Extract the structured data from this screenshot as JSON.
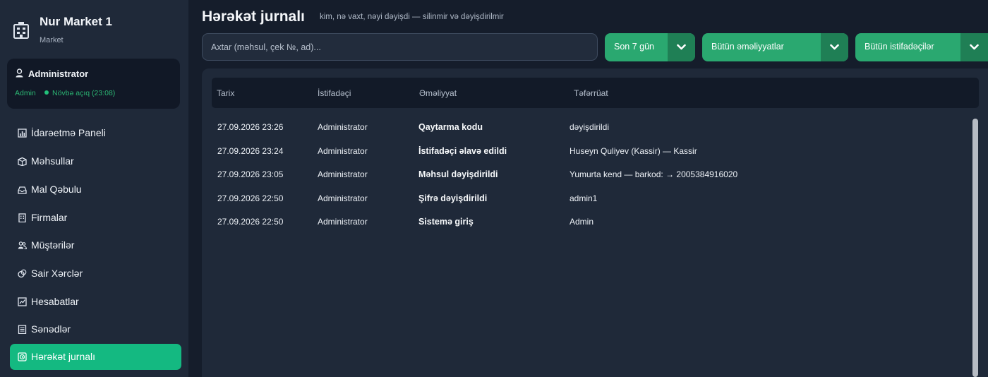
{
  "brand": {
    "name": "Nur Market 1",
    "subtitle": "Market",
    "icon": "building-icon"
  },
  "user": {
    "name": "Administrator",
    "role": "Admin",
    "shift": "Növbə açıq (23:08)",
    "icon": "user-icon"
  },
  "nav": [
    {
      "id": "dashboard",
      "label": "İdarəetmə Paneli",
      "icon": "chart-icon",
      "active": false
    },
    {
      "id": "products",
      "label": "Məhsullar",
      "icon": "box-icon",
      "active": false
    },
    {
      "id": "receiving",
      "label": "Mal Qəbulu",
      "icon": "inbox-icon",
      "active": false
    },
    {
      "id": "firms",
      "label": "Firmalar",
      "icon": "office-icon",
      "active": false
    },
    {
      "id": "customers",
      "label": "Müştərilər",
      "icon": "users-icon",
      "active": false
    },
    {
      "id": "expenses",
      "label": "Sair Xərclər",
      "icon": "coins-icon",
      "active": false
    },
    {
      "id": "reports",
      "label": "Hesabatlar",
      "icon": "report-icon",
      "active": false
    },
    {
      "id": "documents",
      "label": "Sənədlər",
      "icon": "document-icon",
      "active": false
    },
    {
      "id": "activity-log",
      "label": "Hərəkət jurnalı",
      "icon": "log-icon",
      "active": true
    }
  ],
  "header": {
    "title": "Hərəkət jurnalı",
    "subtitle": "kim, nə vaxt, nəyi dəyişdi — silinmir və dəyişdirilmir"
  },
  "toolbar": {
    "search_placeholder": "Axtar (məhsul, çek №, ad)...",
    "period": "Son 7 gün",
    "action_filter": "Bütün əməliyyatlar",
    "user_filter": "Bütün istifadəçilər",
    "accent": "#2aa870",
    "accent_dark": "#1f7f55"
  },
  "table": {
    "columns": [
      "Tarix",
      "İstifadəçi",
      "Əməliyyat",
      "Təfərrüat"
    ],
    "rows": [
      {
        "date": "27.09.2026 23:26",
        "user": "Administrator",
        "action": "Qaytarma kodu",
        "details": "dəyişdirildi"
      },
      {
        "date": "27.09.2026 23:24",
        "user": "Administrator",
        "action": "İstifadəçi əlavə edildi",
        "details": "Huseyn Quliyev (Kassir) — Kassir"
      },
      {
        "date": "27.09.2026 23:05",
        "user": "Administrator",
        "action": "Məhsul dəyişdirildi",
        "details": "Yumurta kend — barkod:  → 2005384916020"
      },
      {
        "date": "27.09.2026 22:50",
        "user": "Administrator",
        "action": "Şifrə dəyişdirildi",
        "details": "admin1"
      },
      {
        "date": "27.09.2026 22:50",
        "user": "Administrator",
        "action": "Sistemə giriş",
        "details": "Admin"
      }
    ]
  }
}
